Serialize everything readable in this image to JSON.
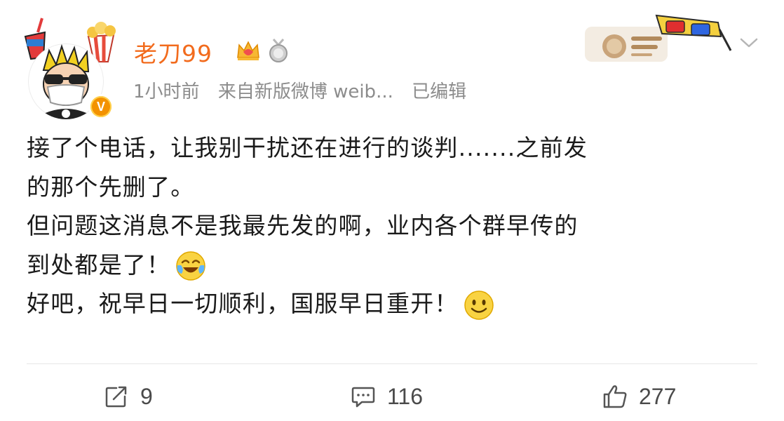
{
  "post": {
    "author": {
      "name": "老刀99",
      "avatar_icon": "cartoon-avatar",
      "verified_icon": "v-badge",
      "verified_label": "V",
      "level_icons": [
        "crown-icon",
        "medal-icon"
      ]
    },
    "meta": {
      "time": "1小时前",
      "source": "来自新版微博 weib...",
      "edited": "已编辑"
    },
    "content_lines": [
      "接了个电话，让我别干扰还在进行的谈判.......之前发",
      "的那个先删了。",
      "但问题这消息不是我最先发的啊，业内各个群早传的",
      "到处都是了！",
      "好吧，祝早日一切顺利，国服早日重开！"
    ],
    "emojis": [
      "laughing-crying-emoji",
      "smile-emoji"
    ],
    "actions": {
      "repost_count": "9",
      "comment_count": "116",
      "like_count": "277"
    }
  },
  "colors": {
    "username": "#f26b1d",
    "meta": "#8c8c8c",
    "text": "#1a1a1a",
    "verified": "#f39200"
  }
}
